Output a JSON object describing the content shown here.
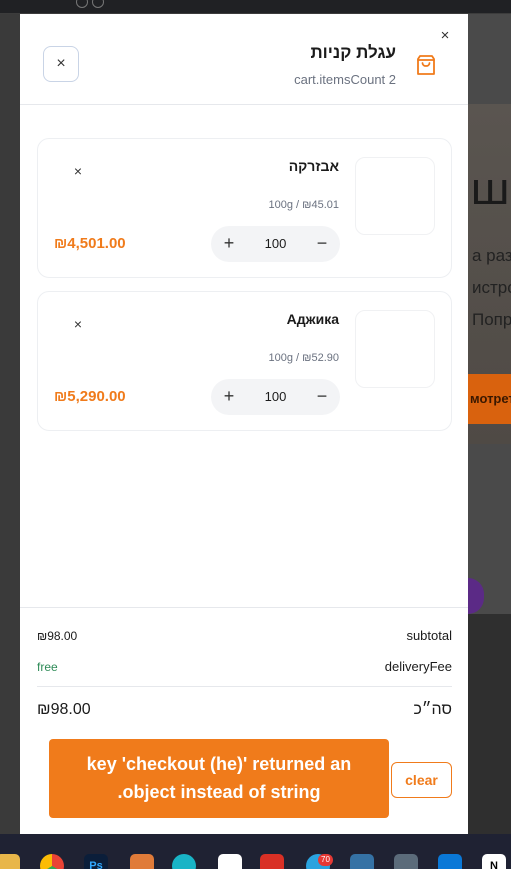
{
  "drawer": {
    "title": "עגלת קניות",
    "subtitle": "cart.itemsCount 2",
    "close_x": "×",
    "close_button": "×"
  },
  "items": [
    {
      "name": "אבזרקה",
      "unit": "100g / ₪45.01",
      "quantity": "100",
      "total": "₪4,501.00",
      "remove": "×",
      "plus": "+",
      "minus": "−"
    },
    {
      "name": "Аджика",
      "unit": "100g / ₪52.90",
      "quantity": "100",
      "total": "₪5,290.00",
      "remove": "×",
      "plus": "+",
      "minus": "−"
    }
  ],
  "summary": {
    "subtotal_label": "subtotal",
    "subtotal_value": "₪98.00",
    "delivery_label": "deliveryFee",
    "delivery_value": "free",
    "total_label": "סה״כ",
    "total_value": "₪98.00",
    "clear_label": "clear"
  },
  "toast": {
    "line1": "key 'checkout (he)' returned an",
    "line2": "object instead of string."
  },
  "colors": {
    "accent": "#f07b1b",
    "free": "#2e8b57",
    "taskbar": "#1f2233"
  },
  "background": {
    "big_text": "ш",
    "line1": "а раз",
    "line2": "истро",
    "line3": "Попр",
    "button": "мотреть"
  },
  "taskbar": {
    "icons": [
      "folder-icon",
      "chrome-icon",
      "photoshop-icon",
      "app-icon",
      "canva-icon",
      "app-icon-2",
      "gmail-icon",
      "telegram-icon",
      "python-icon",
      "calculator-icon",
      "vscode-icon",
      "notion-icon"
    ],
    "badge": "70"
  }
}
